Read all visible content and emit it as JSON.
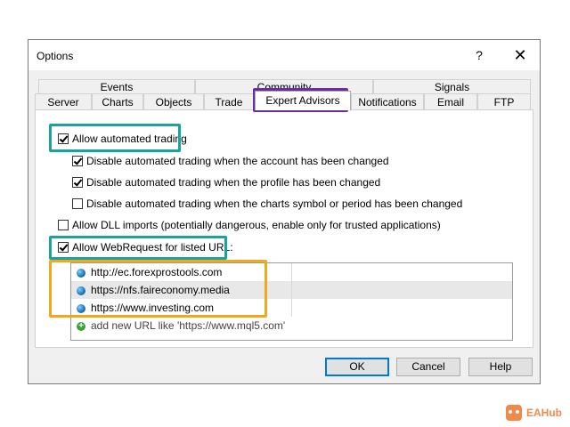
{
  "window": {
    "title": "Options",
    "help": "?",
    "close": "✕"
  },
  "tabs": {
    "row1": [
      "Events",
      "Community",
      "Signals"
    ],
    "row2": [
      "Server",
      "Charts",
      "Objects",
      "Trade",
      "Expert Advisors",
      "Notifications",
      "Email",
      "FTP"
    ],
    "active": "Expert Advisors"
  },
  "options": {
    "allow_automated_trading": {
      "label": "Allow automated trading",
      "checked": true
    },
    "disable_on_account_change": {
      "label": "Disable automated trading when the account has been changed",
      "checked": true
    },
    "disable_on_profile_change": {
      "label": "Disable automated trading when the profile has been changed",
      "checked": true
    },
    "disable_on_symbol_change": {
      "label": "Disable automated trading when the charts symbol or period has been changed",
      "checked": false
    },
    "allow_dll_imports": {
      "label": "Allow DLL imports (potentially dangerous, enable only for trusted applications)",
      "checked": false
    },
    "allow_webrequest": {
      "label": "Allow WebRequest for listed URL:",
      "checked": true
    }
  },
  "urls": [
    "http://ec.forexprostools.com",
    "https://nfs.faireconomy.media",
    "https://www.investing.com"
  ],
  "add_url_hint": "add new URL like 'https://www.mql5.com'",
  "buttons": {
    "ok": "OK",
    "cancel": "Cancel",
    "help": "Help"
  },
  "watermark": {
    "text": "EAHub"
  },
  "colors": {
    "highlight_green": "#1aa39a",
    "highlight_purple": "#6b2ca3",
    "highlight_orange": "#f0a81c",
    "brand": "#f08a4b"
  }
}
